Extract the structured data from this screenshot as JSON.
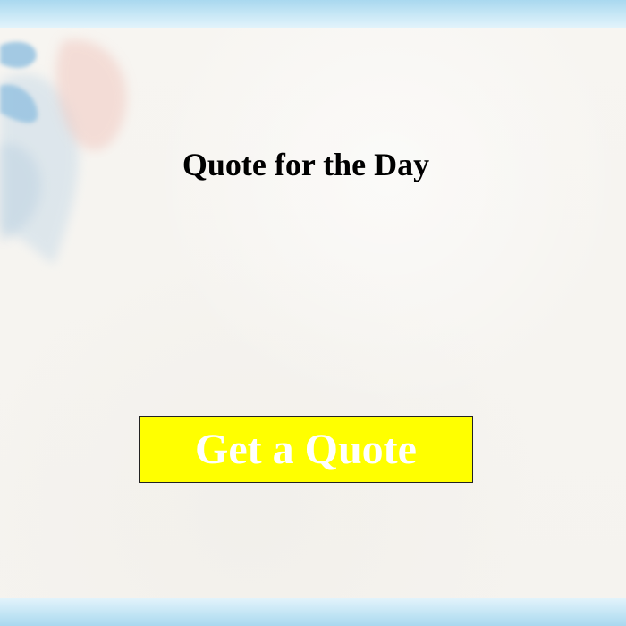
{
  "page": {
    "title": "Quote for the Day"
  },
  "actions": {
    "get_quote_label": "Get a Quote"
  },
  "colors": {
    "button_background": "#ffff00",
    "button_text": "#ffffff",
    "title_text": "#000000",
    "frame_bar": "#a9d8ef"
  }
}
